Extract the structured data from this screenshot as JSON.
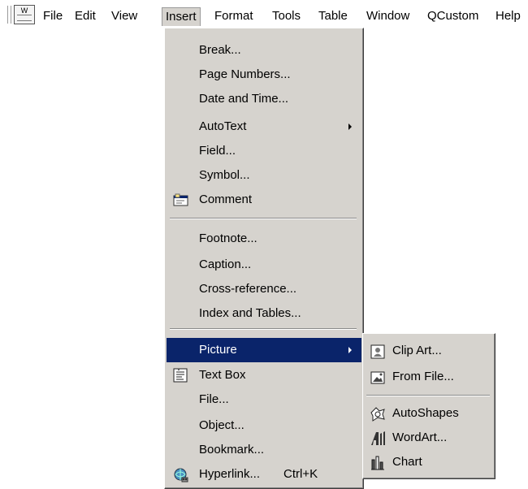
{
  "menubar": {
    "items": [
      {
        "label": "File"
      },
      {
        "label": "Edit"
      },
      {
        "label": "View"
      },
      {
        "label": "Insert"
      },
      {
        "label": "Format"
      },
      {
        "label": "Tools"
      },
      {
        "label": "Table"
      },
      {
        "label": "Window"
      },
      {
        "label": "QCustom"
      },
      {
        "label": "Help"
      }
    ]
  },
  "insert_menu": {
    "items": [
      {
        "label": "Break..."
      },
      {
        "label": "Page Numbers..."
      },
      {
        "label": "Date and Time..."
      },
      {
        "label": "AutoText",
        "submenu": true
      },
      {
        "label": "Field..."
      },
      {
        "label": "Symbol..."
      },
      {
        "label": "Comment",
        "icon": "comment-icon"
      },
      {
        "label": "Footnote..."
      },
      {
        "label": "Caption..."
      },
      {
        "label": "Cross-reference..."
      },
      {
        "label": "Index and Tables..."
      },
      {
        "label": "Picture",
        "submenu": true,
        "highlighted": true
      },
      {
        "label": "Text Box",
        "icon": "text-box-icon"
      },
      {
        "label": "File..."
      },
      {
        "label": "Object..."
      },
      {
        "label": "Bookmark..."
      },
      {
        "label": "Hyperlink...",
        "shortcut": "Ctrl+K",
        "icon": "hyperlink-icon"
      }
    ]
  },
  "picture_submenu": {
    "items": [
      {
        "label": "Clip Art...",
        "icon": "clip-art-icon"
      },
      {
        "label": "From File...",
        "icon": "from-file-icon"
      },
      {
        "label": "AutoShapes",
        "icon": "autoshapes-icon"
      },
      {
        "label": "WordArt...",
        "icon": "wordart-icon"
      },
      {
        "label": "Chart",
        "icon": "chart-icon"
      }
    ]
  },
  "colors": {
    "menu_bg": "#d6d3ce",
    "highlight_bg": "#0a246a",
    "highlight_text": "#ffffff"
  }
}
